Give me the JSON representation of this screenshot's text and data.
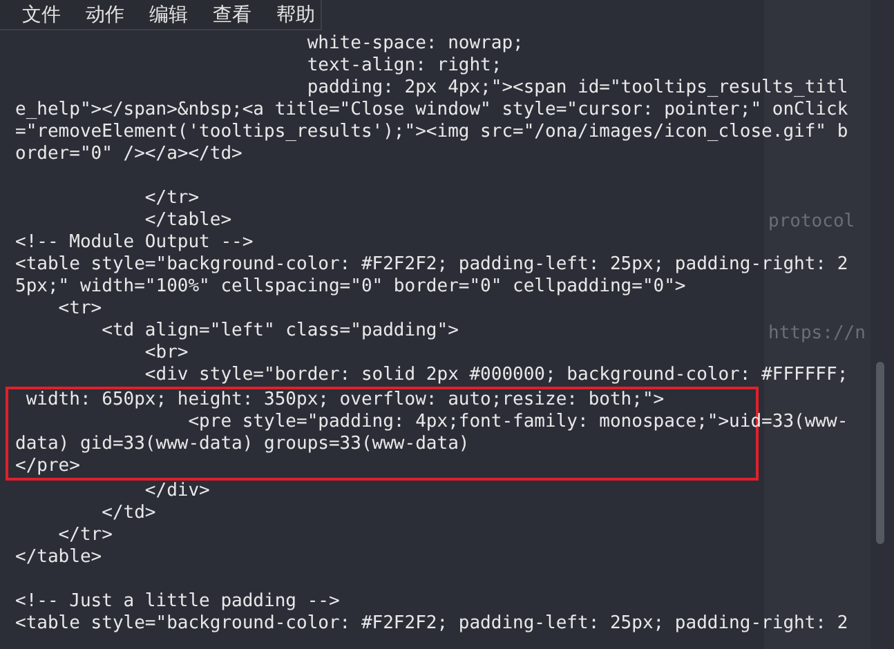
{
  "menu": [
    {
      "label": "文件"
    },
    {
      "label": "动作"
    },
    {
      "label": "编辑"
    },
    {
      "label": "查看"
    },
    {
      "label": "帮助"
    }
  ],
  "side_texts": [
    "protocol",
    "https://n"
  ],
  "blocks": [
    {
      "highlighted": false,
      "space_before": false,
      "lines": [
        "                           white-space: nowrap;",
        "                           text-align: right;",
        "                           padding: 2px 4px;\"><span id=\"tooltips_results_titl",
        "e_help\"></span>&nbsp;<a title=\"Close window\" style=\"cursor: pointer;\" onClick",
        "=\"removeElement('tooltips_results');\"><img src=\"/ona/images/icon_close.gif\" b",
        "order=\"0\" /></a></td>"
      ]
    },
    {
      "highlighted": false,
      "space_before": true,
      "lines": [
        "            </tr>",
        "            </table>",
        "<!-- Module Output -->",
        "<table style=\"background-color: #F2F2F2; padding-left: 25px; padding-right: 2",
        "5px;\" width=\"100%\" cellspacing=\"0\" border=\"0\" cellpadding=\"0\">",
        "    <tr>",
        "        <td align=\"left\" class=\"padding\">",
        "            <br>",
        "            <div style=\"border: solid 2px #000000; background-color: #FFFFFF;"
      ]
    },
    {
      "highlighted": true,
      "space_before": false,
      "lines": [
        " width: 650px; height: 350px; overflow: auto;resize: both;\">",
        "                <pre style=\"padding: 4px;font-family: monospace;\">uid=33(www-",
        "data) gid=33(www-data) groups=33(www-data)",
        "</pre>"
      ]
    },
    {
      "highlighted": false,
      "space_before": false,
      "lines": [
        "            </div>",
        "        </td>",
        "    </tr>",
        "</table>"
      ]
    },
    {
      "highlighted": false,
      "space_before": true,
      "lines": [
        "<!-- Just a little padding -->",
        "<table style=\"background-color: #F2F2F2; padding-left: 25px; padding-right: 2"
      ]
    }
  ]
}
